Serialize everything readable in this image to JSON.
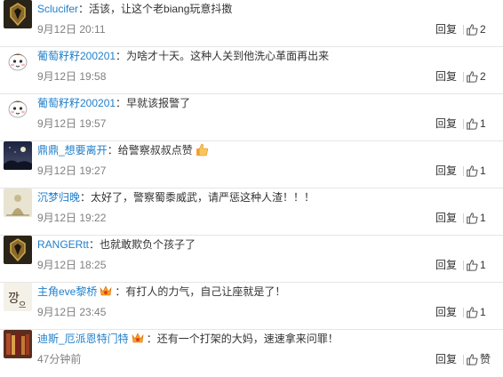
{
  "reply_label": "回复",
  "comments": [
    {
      "user": "Sclucifer",
      "sep": "：",
      "text": "活该，让这个老biang玩意抖擞",
      "time": "9月12日 20:11",
      "likes": "2",
      "avatar_icon": "warcraft-crest-avatar",
      "emoji": ""
    },
    {
      "user": "葡萄籽籽200201",
      "sep": "：",
      "text": "为啥才十天。这种人关到他洗心革面再出来",
      "time": "9月12日 19:58",
      "likes": "2",
      "avatar_icon": "cartoon-face-avatar",
      "emoji": ""
    },
    {
      "user": "葡萄籽籽200201",
      "sep": "：",
      "text": "早就该报警了",
      "time": "9月12日 19:57",
      "likes": "1",
      "avatar_icon": "cartoon-face-avatar",
      "emoji": ""
    },
    {
      "user": "鼎鼎_想要离开",
      "sep": "：",
      "text": "给警察叔叔点赞",
      "time": "9月12日 19:27",
      "likes": "1",
      "avatar_icon": "night-sky-avatar",
      "emoji": "thumbs-up-emoji"
    },
    {
      "user": "沉梦归晚",
      "sep": "：",
      "text": "太好了，警察蜀黍威武，请严惩这种人渣！！！",
      "time": "9月12日 19:22",
      "likes": "1",
      "avatar_icon": "sketch-figure-avatar",
      "emoji": ""
    },
    {
      "user": "RANGERtt",
      "sep": "：",
      "text": "也就敢欺负个孩子了",
      "time": "9月12日 18:25",
      "likes": "1",
      "avatar_icon": "warcraft-crest-avatar",
      "emoji": ""
    },
    {
      "user": "主角eve黎桥",
      "sep": "：",
      "text": "有打人的力气，自己让座就是了！",
      "time": "9月12日 23:45",
      "likes": "1",
      "avatar_icon": "calligraphy-avatar",
      "emoji": "vip-badge-emoji"
    },
    {
      "user": "迪斯_厄派恩特门特",
      "sep": "：",
      "text": "还有一个打架的大妈，速速拿来问罪！",
      "time": "47分钟前",
      "likes": "赞",
      "avatar_icon": "bookshelf-avatar",
      "emoji": "vip-badge-emoji"
    }
  ],
  "colors": {
    "username": "#1f7fcb",
    "meta": "#808080",
    "text": "#333333"
  }
}
